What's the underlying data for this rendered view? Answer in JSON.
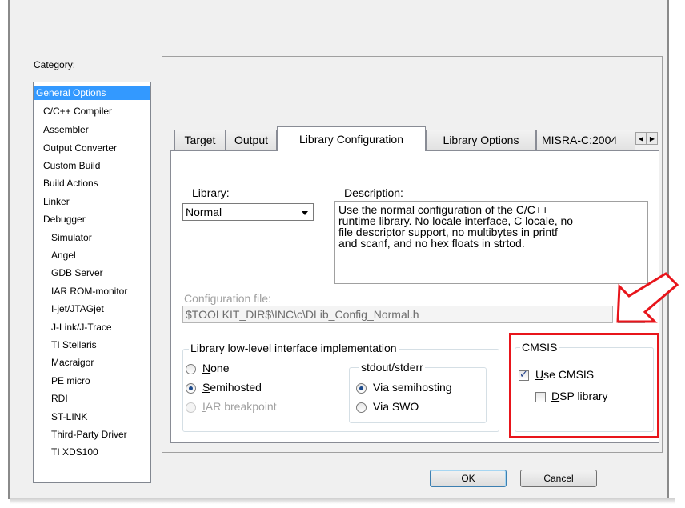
{
  "category_label": "Category:",
  "categories": [
    {
      "label": "General Options",
      "selected": true
    },
    {
      "label": "C/C++ Compiler"
    },
    {
      "label": "Assembler"
    },
    {
      "label": "Output Converter"
    },
    {
      "label": "Custom Build"
    },
    {
      "label": "Build Actions"
    },
    {
      "label": "Linker"
    },
    {
      "label": "Debugger"
    },
    {
      "label": "Simulator"
    },
    {
      "label": "Angel"
    },
    {
      "label": "GDB Server"
    },
    {
      "label": "IAR ROM-monitor"
    },
    {
      "label": "I-jet/JTAGjet"
    },
    {
      "label": "J-Link/J-Trace"
    },
    {
      "label": "TI Stellaris"
    },
    {
      "label": "Macraigor"
    },
    {
      "label": "PE micro"
    },
    {
      "label": "RDI"
    },
    {
      "label": "ST-LINK"
    },
    {
      "label": "Third-Party Driver"
    },
    {
      "label": "TI XDS100"
    }
  ],
  "tabs": [
    "Target",
    "Output",
    "Library Configuration",
    "Library Options",
    "MISRA-C:2004"
  ],
  "library": {
    "label": "Library:",
    "value": "Normal"
  },
  "description": {
    "label": "Description:",
    "lines": [
      "Use the normal configuration of the C/C++",
      "runtime library. No locale interface, C locale, no",
      "file descriptor support, no multibytes in printf",
      "and scanf, and no hex floats in strtod."
    ]
  },
  "config_file": {
    "label": "Configuration file:",
    "value": "$TOOLKIT_DIR$\\INC\\c\\DLib_Config_Normal.h"
  },
  "low_level": {
    "title": "Library low-level interface implementation",
    "options": [
      {
        "label": "None",
        "checked": false,
        "disabled": false
      },
      {
        "label": "Semihosted",
        "checked": true,
        "disabled": false
      },
      {
        "label": "IAR breakpoint",
        "checked": false,
        "disabled": true
      }
    ]
  },
  "stdout": {
    "title": "stdout/stderr",
    "options": [
      {
        "label": "Via semihosting",
        "checked": true
      },
      {
        "label": "Via SWO",
        "checked": false
      }
    ]
  },
  "cmsis": {
    "title": "CMSIS",
    "use_cmsis": {
      "label": "Use CMSIS",
      "checked": true
    },
    "dsp_library": {
      "label": "DSP library",
      "checked": false
    }
  },
  "buttons": {
    "ok": "OK",
    "cancel": "Cancel"
  },
  "colors": {
    "highlight": "#e8151b",
    "selection": "#3399ff"
  }
}
